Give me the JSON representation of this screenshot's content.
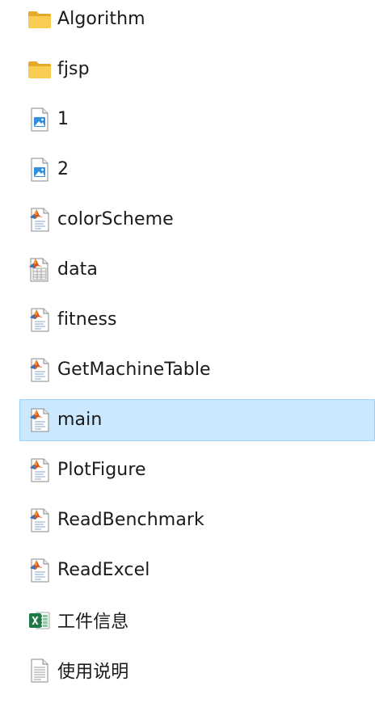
{
  "files": [
    {
      "name": "Algorithm",
      "icon": "folder-icon"
    },
    {
      "name": "fjsp",
      "icon": "folder-icon"
    },
    {
      "name": "1",
      "icon": "image-file-icon"
    },
    {
      "name": "2",
      "icon": "image-file-icon"
    },
    {
      "name": "colorScheme",
      "icon": "matlab-file-icon"
    },
    {
      "name": "data",
      "icon": "matlab-data-file-icon"
    },
    {
      "name": "fitness",
      "icon": "matlab-file-icon"
    },
    {
      "name": "GetMachineTable",
      "icon": "matlab-file-icon"
    },
    {
      "name": "main",
      "icon": "matlab-file-icon",
      "selected": true
    },
    {
      "name": "PlotFigure",
      "icon": "matlab-file-icon"
    },
    {
      "name": "ReadBenchmark",
      "icon": "matlab-file-icon"
    },
    {
      "name": "ReadExcel",
      "icon": "matlab-file-icon"
    },
    {
      "name": "工件信息",
      "icon": "excel-file-icon"
    },
    {
      "name": "使用说明",
      "icon": "text-file-icon"
    }
  ],
  "colors": {
    "selection_bg": "#cce8ff",
    "selection_border": "#99d1ff",
    "folder": "#f8c740",
    "excel": "#1d7a43"
  }
}
